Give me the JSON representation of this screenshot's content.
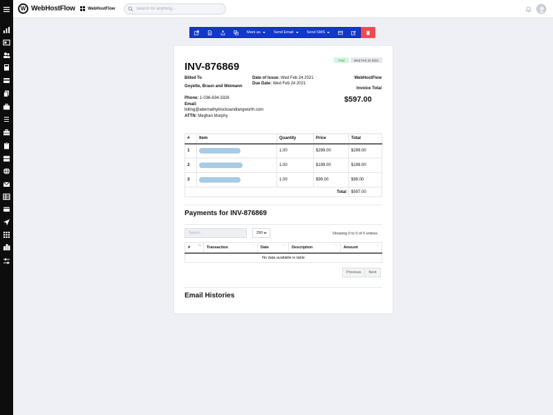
{
  "app": {
    "brand_letter": "W",
    "brand_name": "WebHostFlow",
    "workspace_name": "WebHostFlow",
    "search_placeholder": "Search for anything..."
  },
  "sidebar": {
    "icons": [
      "menu-icon",
      "chart-bar-icon",
      "id-card-icon",
      "users-icon",
      "calculator-icon",
      "credit-card-icon",
      "files-icon",
      "briefcase-icon",
      "list-icon",
      "toolbox-icon",
      "clipboard-icon",
      "server-icon",
      "globe-icon",
      "mail-icon",
      "table-icon",
      "wallet-icon",
      "send-icon",
      "grid-icon",
      "building-icon",
      "sliders-icon"
    ]
  },
  "toolbar": {
    "mark_as": "Mark as",
    "send_email": "Send Email",
    "send_sms": "Send SMS"
  },
  "invoice": {
    "number": "INV-876869",
    "status": "Paid",
    "status_date": "Wed Feb 24 2021",
    "billed_to_label": "Billed To",
    "client": "Goyette, Braun and Weimann",
    "date_issue_label": "Date of Issue:",
    "date_issue": "Wed Feb 24 2021",
    "due_date_label": "Due Date:",
    "due_date": "Wed Feb 24 2021",
    "company": "WebHostFlow",
    "invoice_total_label": "Invoice Total",
    "invoice_total": "$597.00",
    "phone_label": "Phone:",
    "phone": "1-036-634-3326",
    "email_label": "Email:",
    "email": "billing@abernathyklockoandlangworth.com",
    "attn_label": "ATTN:",
    "attn": "Meghan Murphy"
  },
  "items_table": {
    "headers": [
      "#",
      "Item",
      "Quantity",
      "Price",
      "Total"
    ],
    "rows": [
      {
        "n": "1",
        "qty": "1.00",
        "price": "$299.00",
        "total": "$299.00"
      },
      {
        "n": "2",
        "qty": "1.00",
        "price": "$199.00",
        "total": "$199.00"
      },
      {
        "n": "3",
        "qty": "1.00",
        "price": "$99.00",
        "total": "$99.00"
      }
    ],
    "total_label": "Total",
    "grand_total": "$597.00"
  },
  "payments": {
    "title": "Payments for INV-876869",
    "search_placeholder": "Search ...",
    "page_length": "250",
    "showing": "Showing 0 to 0 of 0 entries",
    "headers": [
      "#",
      "Transaction",
      "Date",
      "Description",
      "Amount"
    ],
    "empty": "No data available in table",
    "previous": "Previous",
    "next": "Next"
  },
  "email_histories": {
    "title": "Email Histories"
  },
  "colors": {
    "primary": "#1337c9",
    "danger": "#ef4a54",
    "paid_bg": "#d4f4de",
    "paid_text": "#2ea25a",
    "sidebar": "#0d0d0d"
  }
}
